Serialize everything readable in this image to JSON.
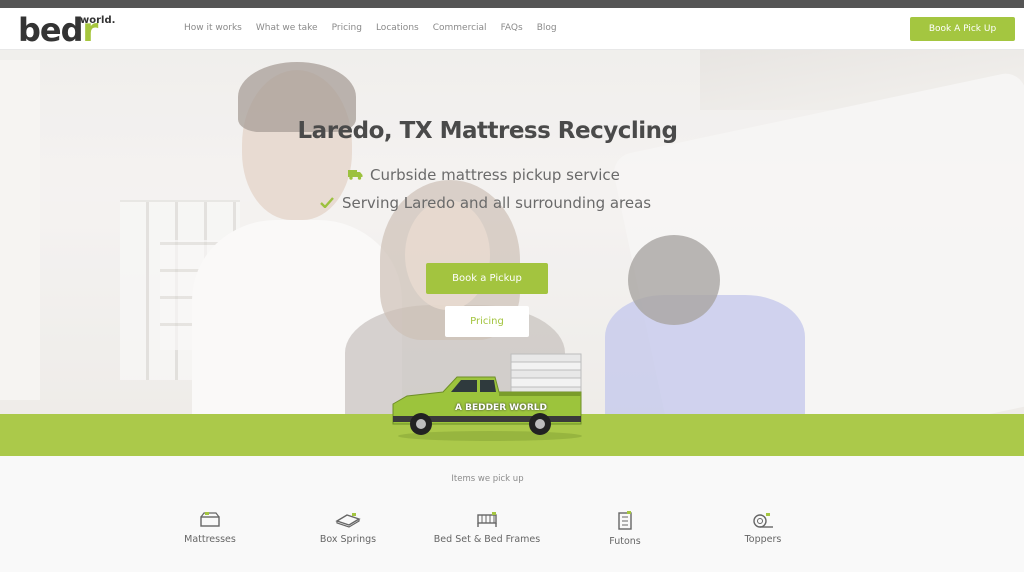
{
  "header": {
    "logo_main": "bed",
    "logo_r": "r",
    "logo_sup": "world.",
    "nav": [
      "How it works",
      "What we take",
      "Pricing",
      "Locations",
      "Commercial",
      "FAQs",
      "Blog"
    ],
    "cta_label": "Book A Pick Up"
  },
  "hero": {
    "title": "Laredo, TX Mattress Recycling",
    "features": [
      {
        "icon": "truck-icon",
        "text": "Curbside mattress pickup service"
      },
      {
        "icon": "check-icon",
        "text": "Serving Laredo and all surrounding areas"
      }
    ],
    "primary_button": "Book a Pickup",
    "secondary_button": "Pricing",
    "truck_text": "A BEDDER WORLD"
  },
  "items": {
    "title": "Items we pick up",
    "list": [
      {
        "icon": "mattress-icon",
        "label": "Mattresses"
      },
      {
        "icon": "box-spring-icon",
        "label": "Box Springs"
      },
      {
        "icon": "bed-frame-icon",
        "label": "Bed Set & Bed Frames"
      },
      {
        "icon": "futon-icon",
        "label": "Futons"
      },
      {
        "icon": "topper-icon",
        "label": "Toppers"
      }
    ]
  },
  "colors": {
    "accent": "#a4c640",
    "band": "#abc94a",
    "topbar": "#555555"
  }
}
